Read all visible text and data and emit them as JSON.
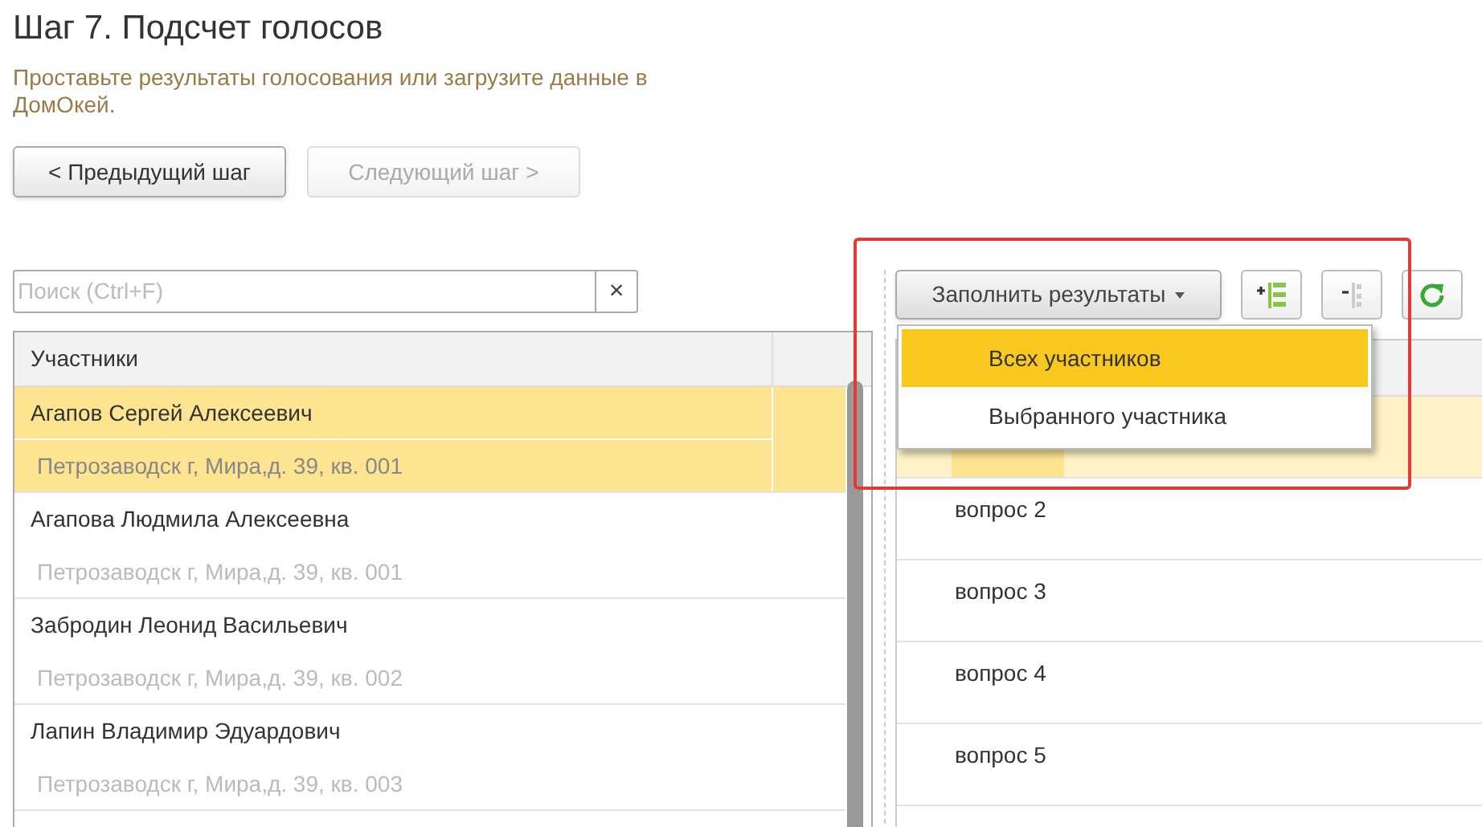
{
  "title": "Шаг 7. Подсчет голосов",
  "subtitle": "Проставьте результаты голосования или загрузите данные в ДомОкей.",
  "nav_buttons": [
    {
      "label": "< Предыдущий шаг",
      "disabled": false
    },
    {
      "label": "Следующий шаг >",
      "disabled": true
    }
  ],
  "search": {
    "placeholder": "Поиск (Ctrl+F)",
    "clear": "×"
  },
  "participants": {
    "columns": [
      "Участники"
    ],
    "rows": [
      {
        "name": "Агапов Сергей Алексеевич",
        "address": "Петрозаводск г, Мира,д. 39, кв. 001",
        "selected": true
      },
      {
        "name": "Агапова Людмила Алексеевна",
        "address": "Петрозаводск г, Мира,д. 39, кв. 001",
        "selected": false
      },
      {
        "name": "Забродин Леонид Васильевич",
        "address": "Петрозаводск г, Мира,д. 39, кв. 002",
        "selected": false
      },
      {
        "name": "Лапин Владимир Эдуардович",
        "address": "Петрозаводск г, Мира,д. 39, кв. 003",
        "selected": false
      }
    ]
  },
  "fill_button": {
    "label": "Заполнить результаты"
  },
  "fill_menu": [
    {
      "label": "Всех участников",
      "selected": true
    },
    {
      "label": "Выбранного участника",
      "selected": false
    }
  ],
  "questions": {
    "rows": [
      {
        "selected": true
      },
      {
        "label": "вопрос 2",
        "selected": false
      },
      {
        "label": "вопрос 3",
        "selected": false
      },
      {
        "label": "вопрос 4",
        "selected": false
      },
      {
        "label": "вопрос 5",
        "selected": false
      }
    ]
  }
}
